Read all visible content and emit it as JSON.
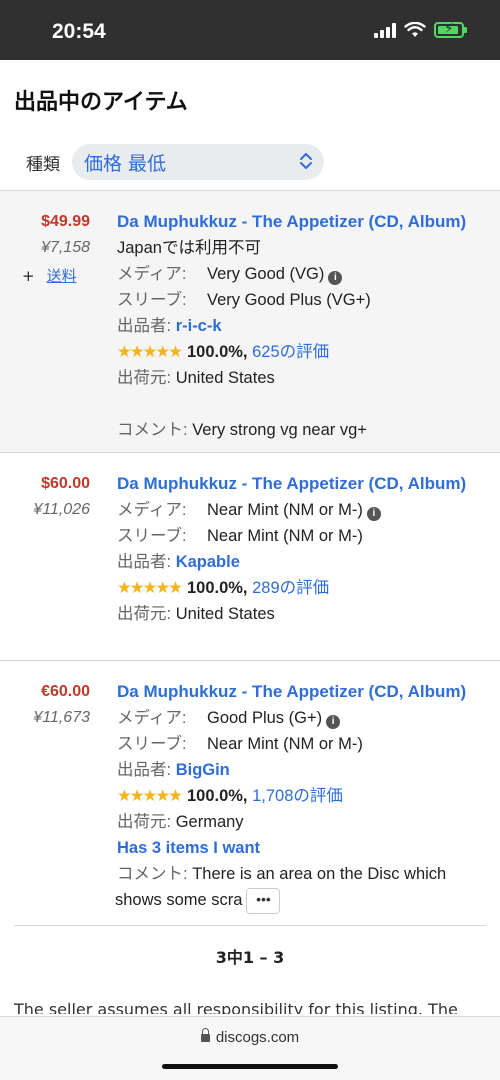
{
  "status_bar": {
    "time": "20:54"
  },
  "page": {
    "title": "出品中のアイテム",
    "sort_label": "種類",
    "sort_value": "価格 最低"
  },
  "listings": [
    {
      "price": "$49.99",
      "price_yen": "¥7,158",
      "shipping_plus": "+",
      "shipping_link": "送料",
      "title": "Da Muphukkuz - The Appetizer (CD, Album)",
      "availability": "Japanでは利用不可",
      "media_label": "メディア:",
      "media_value": "Very Good (VG)",
      "sleeve_label": "スリーブ:",
      "sleeve_value": "Very Good Plus (VG+)",
      "seller_label": "出品者:",
      "seller_name": "r-i-c-k",
      "stars": "★★★★★",
      "rating": "100.0%,",
      "rating_count": "625の評価",
      "ships_label": "出荷元:",
      "ships_from": "United States",
      "comment_label": "コメント:",
      "comment": "Very strong vg near vg+"
    },
    {
      "price": "$60.00",
      "price_yen": "¥11,026",
      "title": "Da Muphukkuz - The Appetizer (CD, Album)",
      "media_label": "メディア:",
      "media_value": "Near Mint (NM or M-)",
      "sleeve_label": "スリーブ:",
      "sleeve_value": "Near Mint (NM or M-)",
      "seller_label": "出品者:",
      "seller_name": "Kapable",
      "stars": "★★★★★",
      "rating": "100.0%,",
      "rating_count": "289の評価",
      "ships_label": "出荷元:",
      "ships_from": "United States"
    },
    {
      "price": "€60.00",
      "price_yen": "¥11,673",
      "title": "Da Muphukkuz - The Appetizer (CD, Album)",
      "media_label": "メディア:",
      "media_value": "Good Plus (G+)",
      "sleeve_label": "スリーブ:",
      "sleeve_value": "Near Mint (NM or M-)",
      "seller_label": "出品者:",
      "seller_name": "BigGin",
      "stars": "★★★★★",
      "rating": "100.0%,",
      "rating_count": "1,708の評価",
      "ships_label": "出荷元:",
      "ships_from": "Germany",
      "want_text": "Has 3 items I want",
      "comment_label": "コメント:",
      "comment_line1": "There is an area on the Disc which",
      "comment_line2": "shows some scra",
      "more_label": "•••"
    }
  ],
  "pagination": "3中1 – 3",
  "disclaimer": "The seller assumes all responsibility for this listing. The",
  "browser": {
    "url": "discogs.com"
  },
  "icons": {
    "status": [
      "signal-icon",
      "wifi-icon",
      "battery-charging-icon"
    ],
    "sort": "chevron-up-down-icon",
    "info": "info-icon",
    "lock": "lock-icon"
  },
  "colors": {
    "link": "#2f6dd8",
    "price": "#c0392b",
    "stars": "#f3b31b",
    "status_bar": "#303030",
    "battery": "#4cd964"
  }
}
